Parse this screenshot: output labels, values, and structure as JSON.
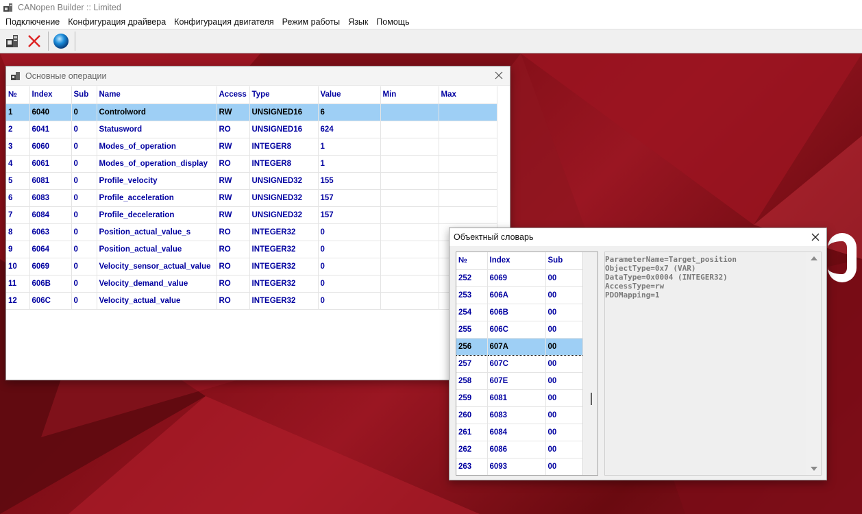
{
  "app": {
    "title": "CANopen Builder :: Limited"
  },
  "menu": {
    "items": [
      "Подключение",
      "Конфигурация драйвера",
      "Конфигурация двигателя",
      "Режим работы",
      "Язык",
      "Помощь"
    ]
  },
  "toolbar": {
    "icons": [
      "connect-icon",
      "disconnect-icon",
      "globe-icon"
    ]
  },
  "ops_window": {
    "title": "Основные операции",
    "columns": [
      "№",
      "Index",
      "Sub",
      "Name",
      "Access",
      "Type",
      "Value",
      "Min",
      "Max"
    ],
    "selected_row": 0,
    "rows": [
      [
        "1",
        "6040",
        "0",
        "Controlword",
        "RW",
        "UNSIGNED16",
        "6",
        "",
        ""
      ],
      [
        "2",
        "6041",
        "0",
        "Statusword",
        "RO",
        "UNSIGNED16",
        "624",
        "",
        ""
      ],
      [
        "3",
        "6060",
        "0",
        "Modes_of_operation",
        "RW",
        "INTEGER8",
        "1",
        "",
        ""
      ],
      [
        "4",
        "6061",
        "0",
        "Modes_of_operation_display",
        "RO",
        "INTEGER8",
        "1",
        "",
        ""
      ],
      [
        "5",
        "6081",
        "0",
        "Profile_velocity",
        "RW",
        "UNSIGNED32",
        "155",
        "",
        ""
      ],
      [
        "6",
        "6083",
        "0",
        "Profile_acceleration",
        "RW",
        "UNSIGNED32",
        "157",
        "",
        ""
      ],
      [
        "7",
        "6084",
        "0",
        "Profile_deceleration",
        "RW",
        "UNSIGNED32",
        "157",
        "",
        ""
      ],
      [
        "8",
        "6063",
        "0",
        "Position_actual_value_s",
        "RO",
        "INTEGER32",
        "0",
        "",
        ""
      ],
      [
        "9",
        "6064",
        "0",
        "Position_actual_value",
        "RO",
        "INTEGER32",
        "0",
        "",
        ""
      ],
      [
        "10",
        "6069",
        "0",
        "Velocity_sensor_actual_value",
        "RO",
        "INTEGER32",
        "0",
        "",
        ""
      ],
      [
        "11",
        "606B",
        "0",
        "Velocity_demand_value",
        "RO",
        "INTEGER32",
        "0",
        "",
        ""
      ],
      [
        "12",
        "606C",
        "0",
        "Velocity_actual_value",
        "RO",
        "INTEGER32",
        "0",
        "",
        ""
      ]
    ]
  },
  "objdict_window": {
    "title": "Объектный словарь",
    "columns": [
      "№",
      "Index",
      "Sub"
    ],
    "selected_row": 4,
    "rows": [
      [
        "252",
        "6069",
        "00"
      ],
      [
        "253",
        "606A",
        "00"
      ],
      [
        "254",
        "606B",
        "00"
      ],
      [
        "255",
        "606C",
        "00"
      ],
      [
        "256",
        "607A",
        "00"
      ],
      [
        "257",
        "607C",
        "00"
      ],
      [
        "258",
        "607E",
        "00"
      ],
      [
        "259",
        "6081",
        "00"
      ],
      [
        "260",
        "6083",
        "00"
      ],
      [
        "261",
        "6084",
        "00"
      ],
      [
        "262",
        "6086",
        "00"
      ],
      [
        "263",
        "6093",
        "00"
      ]
    ],
    "info_lines": [
      "ParameterName=Target_position",
      "ObjectType=0x7 (VAR)",
      "DataType=0x0004 (INTEGER32)",
      "AccessType=rw",
      "PDOMapping=1"
    ]
  }
}
